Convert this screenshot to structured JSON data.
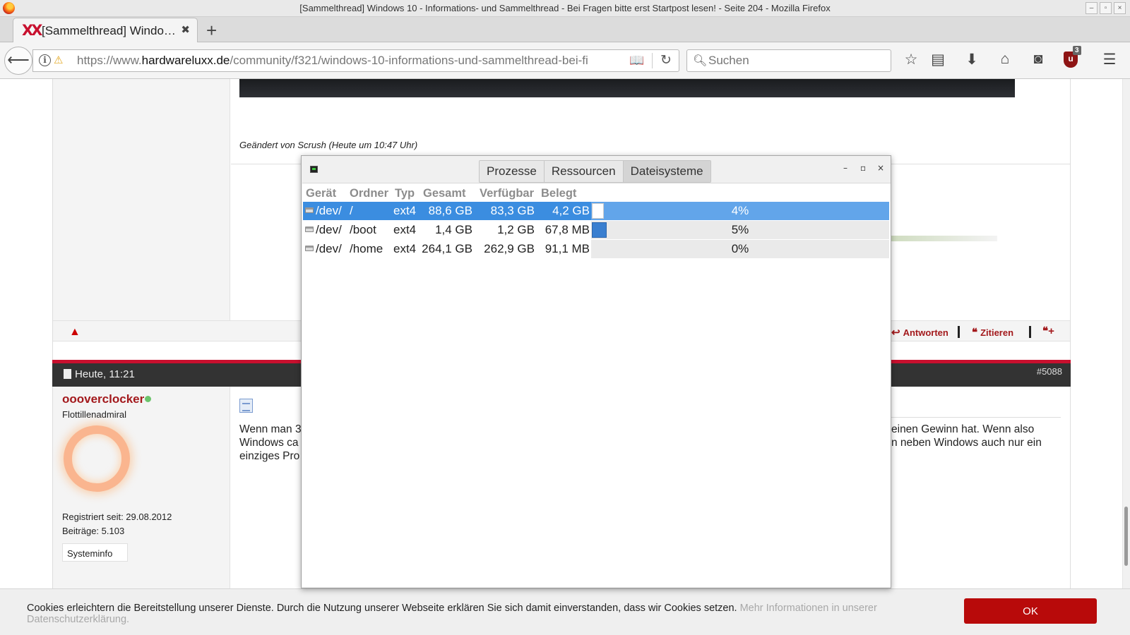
{
  "browser": {
    "window_title": "[Sammelthread] Windows 10 - Informations- und Sammelthread - Bei Fragen bitte erst Startpost lesen! - Seite 204 - Mozilla Firefox",
    "tab_title": "[Sammelthread] Windo…",
    "url_prefix": "https://www.",
    "url_domain": "hardwareluxx.de",
    "url_path": "/community/f321/windows-10-informations-und-sammelthread-bei-fi",
    "search_placeholder": "Suchen",
    "ublock_badge": "3",
    "icons": [
      "firefox-icon",
      "back-icon",
      "info-icon",
      "insecure-lock-icon",
      "reader-view-icon",
      "reload-icon",
      "search-icon",
      "bookmark-star-icon",
      "library-icon",
      "download-icon",
      "home-icon",
      "pocket-icon",
      "ublock-icon",
      "menu-icon"
    ]
  },
  "forum": {
    "post1": {
      "changed_note": "Geändert von Scrush (Heute um 10:47 Uhr)",
      "action_reply": "Antworten",
      "action_quote": "Zitieren"
    },
    "post2": {
      "date": "Heute, 11:21",
      "number": "#5088",
      "username": "oooverclocker",
      "rank": "Flottillenadmiral",
      "registered": "Registriert seit:  29.08.2012",
      "posts": "Beiträge:  5.103",
      "sysinfo_button": "Systeminfo",
      "text_line1_left": "Wenn man 3",
      "text_line1_right": "einen Gewinn hat. Wenn also",
      "text_line2_left": "Windows ca",
      "text_line2_right": "n neben Windows auch nur ein",
      "text_line3_left": "einziges Pro"
    }
  },
  "cookie_banner": {
    "text": "Cookies erleichtern die Bereitstellung unserer Dienste. Durch die Nutzung unserer Webseite erklären Sie sich damit einverstanden, dass wir Cookies setzen.",
    "more_link": "Mehr Informationen in unserer Datenschutzerklärung.",
    "ok_button": "OK"
  },
  "system_monitor": {
    "tabs": [
      "Prozesse",
      "Ressourcen",
      "Dateisysteme"
    ],
    "active_tab": "Dateisysteme",
    "window_controls": {
      "minimize": "–",
      "maximize": "▫",
      "close": "×"
    },
    "columns": [
      "Gerät",
      "Ordner",
      "Typ",
      "Gesamt",
      "Verfügbar",
      "Belegt"
    ],
    "rows": [
      {
        "device": "/dev/",
        "folder": "/",
        "type": "ext4",
        "total": "88,6 GB",
        "available": "83,3 GB",
        "used": "4,2 GB",
        "percent": "4%",
        "percent_value": 4,
        "selected": true
      },
      {
        "device": "/dev/",
        "folder": "/boot",
        "type": "ext4",
        "total": "1,4 GB",
        "available": "1,2 GB",
        "used": "67,8 MB",
        "percent": "5%",
        "percent_value": 5,
        "selected": false
      },
      {
        "device": "/dev/",
        "folder": "/home",
        "type": "ext4",
        "total": "264,1 GB",
        "available": "262,9 GB",
        "used": "91,1 MB",
        "percent": "0%",
        "percent_value": 0,
        "selected": false
      }
    ]
  },
  "colors": {
    "accent_red": "#c8102e",
    "selection_blue": "#3b8de0",
    "ok_button": "#b80a0a"
  }
}
